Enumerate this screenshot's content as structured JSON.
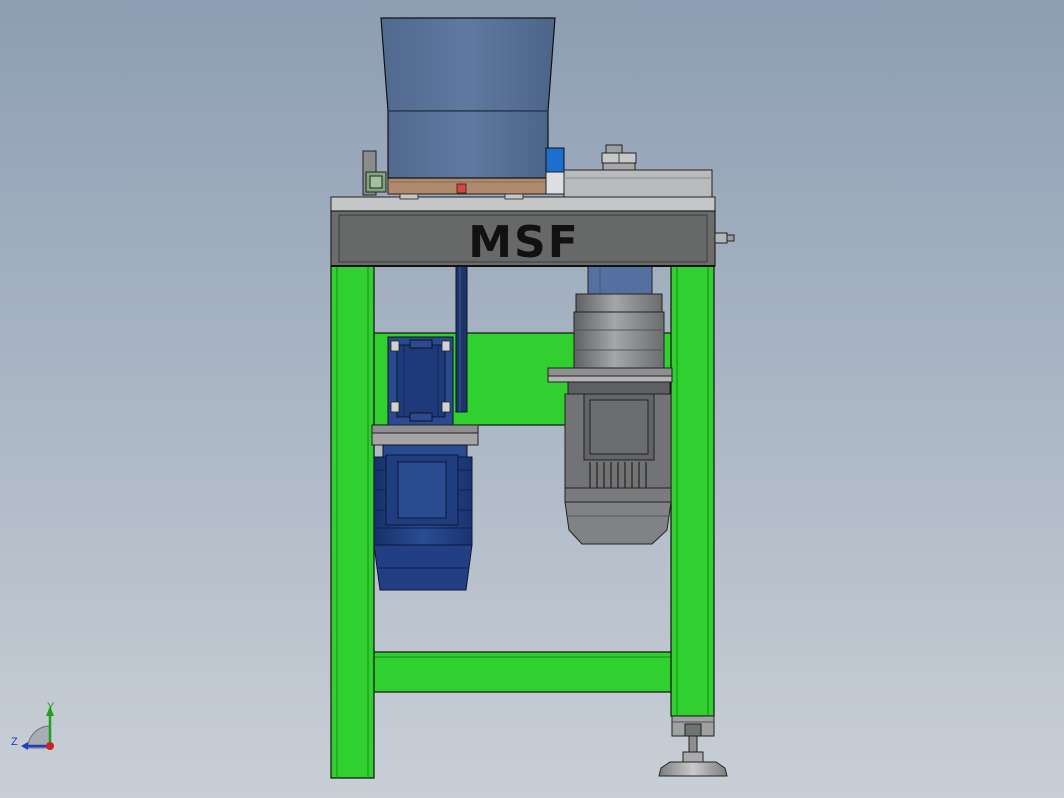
{
  "model": {
    "brand_text": "MSF"
  },
  "triad": {
    "y_label": "Y",
    "z_label": "Z"
  },
  "colors": {
    "background_top": "#8d9eb3",
    "background_bottom": "#c9cfd6",
    "frame_green": "#2fd02f",
    "hopper_blue": "#5a76a0",
    "motor_navy": "#1f3a7a",
    "gearmotor_gray": "#7e8083",
    "table_plate": "#6b6c6c",
    "wood": "#b08a6d"
  }
}
